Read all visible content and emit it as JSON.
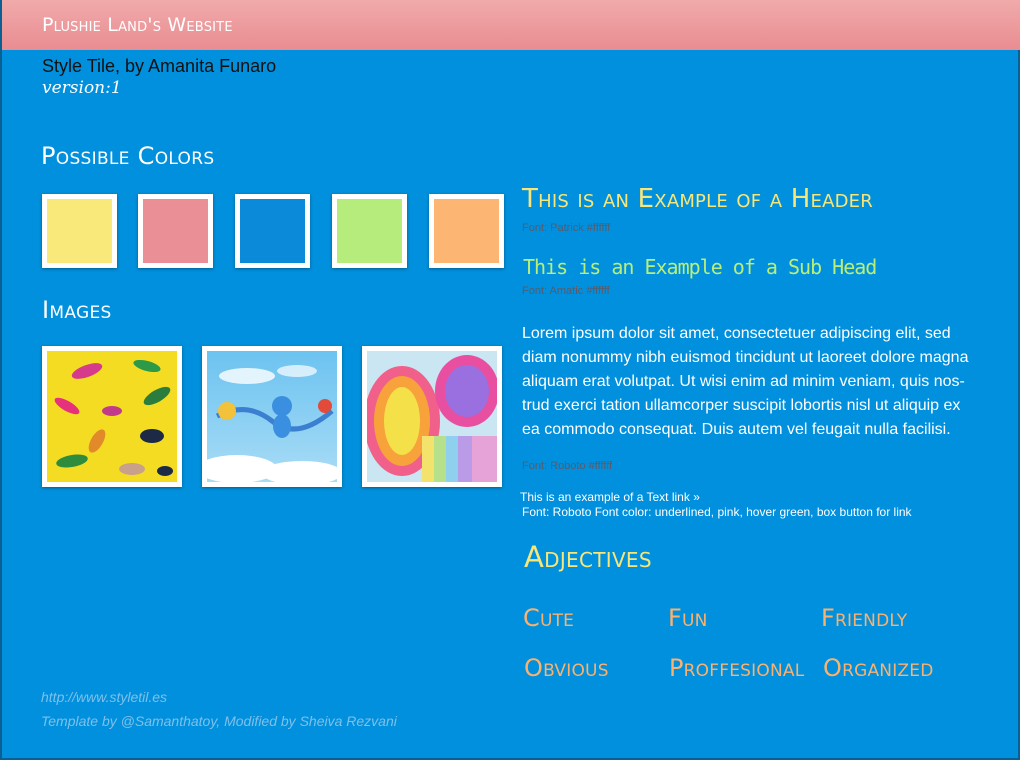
{
  "header": {
    "site_title": "Plushie Land's Website"
  },
  "intro": {
    "byline": "Style Tile, by Amanita Funaro",
    "version": "version:1"
  },
  "colors": {
    "heading": "Possible Colors",
    "swatches": [
      {
        "name": "yellow",
        "hex": "#f9e97a"
      },
      {
        "name": "pink",
        "hex": "#ea8f96"
      },
      {
        "name": "blue",
        "hex": "#0b8ad9"
      },
      {
        "name": "green",
        "hex": "#b6ec7b"
      },
      {
        "name": "orange",
        "hex": "#fdb574"
      }
    ]
  },
  "images": {
    "heading": "Images",
    "items": [
      {
        "name": "toy-animals-photo",
        "description_icon": "toy-dinosaurs-image"
      },
      {
        "name": "toy-figures-sky-photo",
        "description_icon": "toy-monkeys-image"
      },
      {
        "name": "slinky-photo",
        "description_icon": "rainbow-slinky-image"
      }
    ]
  },
  "typography": {
    "header_example": "This is an Example of a Header",
    "header_font_note": "Font: Patrick #ffffff",
    "subhead_example": "This is an Example of a Sub Head",
    "subhead_font_note": "Font: Amatic #ffffff",
    "body_text": "Lorem ipsum dolor sit amet, consectetuer adipiscing elit, sed diam nonummy nibh euismod tincidunt ut laoreet dolore magna aliquam erat volutpat. Ut wisi enim ad minim veniam, quis nos-trud exerci tation ullamcorper suscipit lobortis nisl ut aliquip ex ea commodo consequat. Duis autem vel feugait nulla facilisi.",
    "body_font_note": "Font: Roboto #ffffff",
    "text_link": "This is an example of a Text link »",
    "link_font_note": "Font: Roboto Font color: underlined, pink, hover green, box button for link"
  },
  "adjectives": {
    "heading": "Adjectives",
    "words": [
      "Cute",
      "Fun",
      "Friendly",
      "Obvious",
      "Proffesional",
      "Organized"
    ]
  },
  "footer": {
    "url": "http://www.styletil.es",
    "credit": "Template by @Samanthatoy, Modified by Sheiva Rezvani"
  },
  "theme": {
    "background": "#0090dd",
    "topbar": "#ec9a9f",
    "header_text": "#f8e678",
    "subhead_text": "#b8ee7a",
    "adjective_text": "#fbb26e"
  }
}
